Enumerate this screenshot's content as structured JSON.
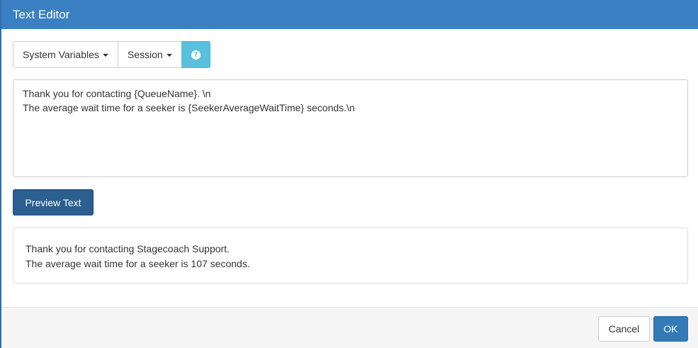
{
  "dialog": {
    "title": "Text Editor"
  },
  "toolbar": {
    "system_variables_label": "System Variables",
    "session_label": "Session",
    "help_glyph": "?",
    "help_icon": "question-circle-icon"
  },
  "editor": {
    "line1": "Thank you for contacting {QueueName}. \\n",
    "line2": "The average wait time for a seeker is {SeekerAverageWaitTime} seconds.\\n"
  },
  "preview": {
    "button_label": "Preview Text",
    "line1": "Thank you for contacting Stagecoach Support.",
    "line2": "The average wait time for a seeker is 107 seconds."
  },
  "footer": {
    "cancel_label": "Cancel",
    "ok_label": "OK"
  },
  "colors": {
    "header": "#3a80c2",
    "help_button": "#5bc0de",
    "preview_button": "#2a5f8f",
    "ok_button": "#337ab7"
  }
}
